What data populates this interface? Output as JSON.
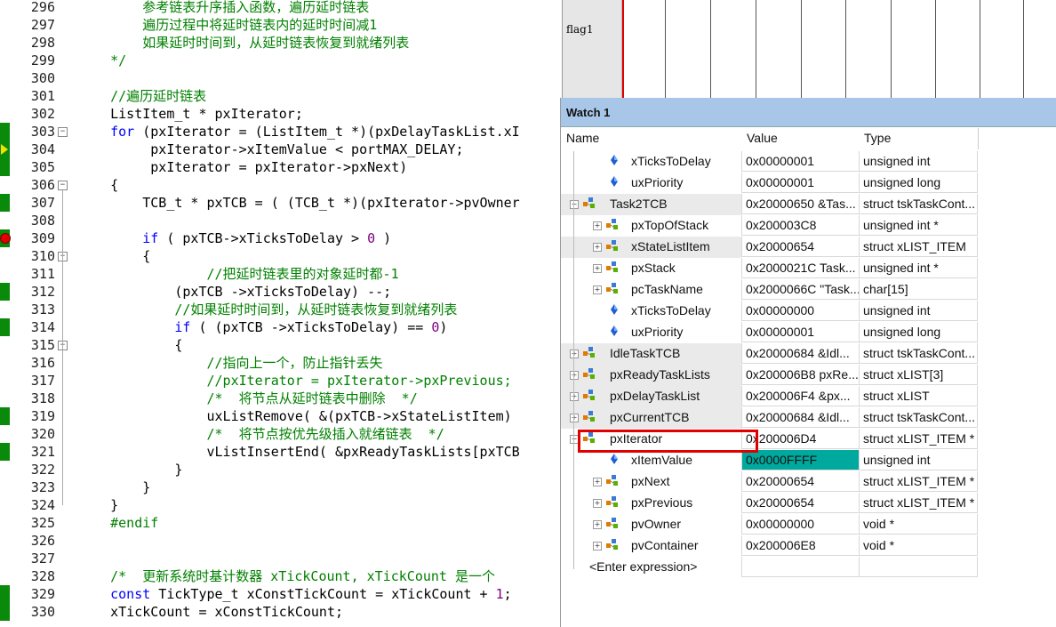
{
  "editor": {
    "lines": [
      {
        "no": "296",
        "text": "        参考链表升序插入函数，遍历延时链表",
        "cls": "cm"
      },
      {
        "no": "297",
        "text": "        遍历过程中将延时链表内的延时时间减1",
        "cls": "cm"
      },
      {
        "no": "298",
        "text": "        如果延时时间到，从延时链表恢复到就绪列表",
        "cls": "cm"
      },
      {
        "no": "299",
        "text": "    */",
        "cls": "cm"
      },
      {
        "no": "300",
        "text": "",
        "cls": ""
      },
      {
        "no": "301",
        "text": "    //遍历延时链表",
        "cls": "cm"
      },
      {
        "no": "302",
        "text": "    ListItem_t * pxIterator;",
        "cls": ""
      },
      {
        "no": "303",
        "text": "    for (pxIterator = (ListItem_t *)(pxDelayTaskList.xI",
        "cls": "for"
      },
      {
        "no": "304",
        "text": "         pxIterator->xItemValue < portMAX_DELAY;",
        "cls": ""
      },
      {
        "no": "305",
        "text": "         pxIterator = pxIterator->pxNext)",
        "cls": ""
      },
      {
        "no": "306",
        "text": "    {",
        "cls": ""
      },
      {
        "no": "307",
        "text": "        TCB_t * pxTCB = ( (TCB_t *)(pxIterator->pvOwner",
        "cls": ""
      },
      {
        "no": "308",
        "text": "",
        "cls": ""
      },
      {
        "no": "309",
        "text": "        if ( pxTCB->xTicksToDelay > 0 )",
        "cls": "if"
      },
      {
        "no": "310",
        "text": "        {",
        "cls": ""
      },
      {
        "no": "311",
        "text": "                //把延时链表里的对象延时都-1",
        "cls": "cm"
      },
      {
        "no": "312",
        "text": "            (pxTCB ->xTicksToDelay) --;",
        "cls": ""
      },
      {
        "no": "313",
        "text": "            //如果延时时间到，从延时链表恢复到就绪列表",
        "cls": "cm"
      },
      {
        "no": "314",
        "text": "            if ( (pxTCB ->xTicksToDelay) == 0)",
        "cls": "if2"
      },
      {
        "no": "315",
        "text": "            {",
        "cls": ""
      },
      {
        "no": "316",
        "text": "                //指向上一个，防止指针丢失",
        "cls": "cm"
      },
      {
        "no": "317",
        "text": "                //pxIterator = pxIterator->pxPrevious; ",
        "cls": "cm"
      },
      {
        "no": "318",
        "text": "                /*  将节点从延时链表中删除  */",
        "cls": "cm"
      },
      {
        "no": "319",
        "text": "                uxListRemove( &(pxTCB->xStateListItem)",
        "cls": ""
      },
      {
        "no": "320",
        "text": "                /*  将节点按优先级插入就绪链表  */",
        "cls": "cm"
      },
      {
        "no": "321",
        "text": "                vListInsertEnd( &pxReadyTaskLists[pxTCB",
        "cls": ""
      },
      {
        "no": "322",
        "text": "            }",
        "cls": ""
      },
      {
        "no": "323",
        "text": "        }",
        "cls": ""
      },
      {
        "no": "324",
        "text": "    }",
        "cls": ""
      },
      {
        "no": "325",
        "text": "    #endif",
        "cls": "pp"
      },
      {
        "no": "326",
        "text": "",
        "cls": ""
      },
      {
        "no": "327",
        "text": "",
        "cls": ""
      },
      {
        "no": "328",
        "text": "    /*  更新系统时基计数器 xTickCount, xTickCount 是一个",
        "cls": "cm"
      },
      {
        "no": "329",
        "text": "    const TickType_t xConstTickCount = xTickCount + 1;",
        "cls": "const"
      },
      {
        "no": "330",
        "text": "    xTickCount = xConstTickCount;",
        "cls": ""
      }
    ]
  },
  "logic": {
    "signal_label": "flag1"
  },
  "watch": {
    "title": "Watch 1",
    "headers": {
      "name": "Name",
      "value": "Value",
      "type": "Type"
    },
    "rows": [
      {
        "name": "xTicksToDelay",
        "value": "0x00000001",
        "type": "unsigned int",
        "indent": 2,
        "icon": "field",
        "exp": false
      },
      {
        "name": "uxPriority",
        "value": "0x00000001",
        "type": "unsigned long",
        "indent": 2,
        "icon": "field",
        "exp": false
      },
      {
        "name": "Task2TCB",
        "value": "0x20000650 &Tas...",
        "type": "struct tskTaskCont...",
        "indent": 0,
        "icon": "struct",
        "exp": "−",
        "hl": true
      },
      {
        "name": "pxTopOfStack",
        "value": "0x200003C8",
        "type": "unsigned int *",
        "indent": 1,
        "icon": "struct",
        "exp": "+"
      },
      {
        "name": "xStateListItem",
        "value": "0x20000654",
        "type": "struct xLIST_ITEM",
        "indent": 1,
        "icon": "struct",
        "exp": "+",
        "hl": true
      },
      {
        "name": "pxStack",
        "value": "0x2000021C Task...",
        "type": "unsigned int *",
        "indent": 1,
        "icon": "struct",
        "exp": "+"
      },
      {
        "name": "pcTaskName",
        "value": "0x2000066C \"Task...",
        "type": "char[15]",
        "indent": 1,
        "icon": "struct",
        "exp": "+"
      },
      {
        "name": "xTicksToDelay",
        "value": "0x00000000",
        "type": "unsigned int",
        "indent": 2,
        "icon": "field",
        "exp": false
      },
      {
        "name": "uxPriority",
        "value": "0x00000001",
        "type": "unsigned long",
        "indent": 2,
        "icon": "field",
        "exp": false
      },
      {
        "name": "IdleTaskTCB",
        "value": "0x20000684 &Idl...",
        "type": "struct tskTaskCont...",
        "indent": 0,
        "icon": "struct",
        "exp": "+",
        "hl": true
      },
      {
        "name": "pxReadyTaskLists",
        "value": "0x200006B8 pxRe...",
        "type": "struct xLIST[3]",
        "indent": 0,
        "icon": "struct",
        "exp": "+",
        "hl": true
      },
      {
        "name": "pxDelayTaskList",
        "value": "0x200006F4 &px...",
        "type": "struct xLIST",
        "indent": 0,
        "icon": "struct",
        "exp": "+",
        "hl": true
      },
      {
        "name": "pxCurrentTCB",
        "value": "0x20000684 &Idl...",
        "type": "struct tskTaskCont...",
        "indent": 0,
        "icon": "struct",
        "exp": "+",
        "hl": true
      },
      {
        "name": "pxIterator",
        "value": "0x200006D4",
        "type": "struct xLIST_ITEM *",
        "indent": 0,
        "icon": "struct",
        "exp": "−"
      },
      {
        "name": "xItemValue",
        "value": "0x0000FFFF",
        "type": "unsigned int",
        "indent": 2,
        "icon": "field",
        "exp": false,
        "teal": true
      },
      {
        "name": "pxNext",
        "value": "0x20000654",
        "type": "struct xLIST_ITEM *",
        "indent": 1,
        "icon": "struct",
        "exp": "+"
      },
      {
        "name": "pxPrevious",
        "value": "0x20000654",
        "type": "struct xLIST_ITEM *",
        "indent": 1,
        "icon": "struct",
        "exp": "+"
      },
      {
        "name": "pvOwner",
        "value": "0x00000000",
        "type": "void *",
        "indent": 1,
        "icon": "struct",
        "exp": "+"
      },
      {
        "name": "pvContainer",
        "value": "0x200006E8",
        "type": "void *",
        "indent": 1,
        "icon": "struct",
        "exp": "+"
      },
      {
        "name": "<Enter expression>",
        "value": "",
        "type": "",
        "indent": -1,
        "icon": "none",
        "exp": false
      }
    ]
  },
  "colors": {
    "green_mark": "#0a8a0a",
    "breakpoint": "#e00000",
    "watch_title": "#a8c6e8",
    "teal": "#00a99d"
  }
}
